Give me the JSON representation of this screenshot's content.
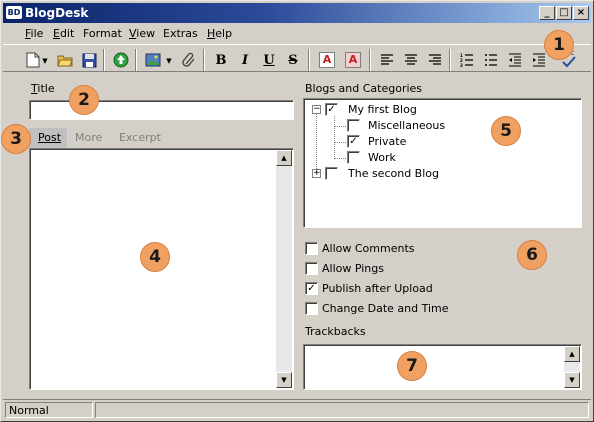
{
  "window": {
    "title": "BlogDesk",
    "logo_text": "BD"
  },
  "menu": {
    "items": [
      {
        "mnemonic": "F",
        "rest": "ile"
      },
      {
        "mnemonic": "E",
        "rest": "dit"
      },
      {
        "mnemonic": "",
        "rest": "Format"
      },
      {
        "mnemonic": "V",
        "rest": "iew"
      },
      {
        "mnemonic": "",
        "rest": "Extras"
      },
      {
        "mnemonic": "H",
        "rest": "elp"
      }
    ]
  },
  "toolbar": {
    "bold_label": "B",
    "italic_label": "I",
    "underline_label": "U",
    "strike_label": "S",
    "font_color_label": "A",
    "highlight_label": "A",
    "spellcheck_label": "ABC"
  },
  "title_field": {
    "label_mnemonic": "T",
    "label_rest": "itle",
    "value": ""
  },
  "editor_tabs": [
    {
      "label": "Post",
      "active": true
    },
    {
      "label": "More",
      "active": false
    },
    {
      "label": "Excerpt",
      "active": false
    }
  ],
  "blogs": {
    "label": "Blogs and Categories",
    "tree": [
      {
        "label": "My first Blog",
        "checked": true,
        "expander": "−"
      },
      {
        "label": "Miscellaneous",
        "checked": false
      },
      {
        "label": "Private",
        "checked": true
      },
      {
        "label": "Work",
        "checked": false
      },
      {
        "label": "The second Blog",
        "checked": false,
        "expander": "+"
      }
    ]
  },
  "options": [
    {
      "label": "Allow Comments",
      "checked": false
    },
    {
      "label": "Allow Pings",
      "checked": false
    },
    {
      "label": "Publish after Upload",
      "checked": true
    },
    {
      "label": "Change Date and Time",
      "checked": false
    }
  ],
  "trackbacks": {
    "label": "Trackbacks",
    "value": ""
  },
  "status": {
    "mode": "Normal"
  },
  "badges": [
    "1",
    "2",
    "3",
    "4",
    "5",
    "6",
    "7"
  ],
  "colors": {
    "badge": "#f0a060",
    "title_gradient_start": "#0a246a"
  }
}
